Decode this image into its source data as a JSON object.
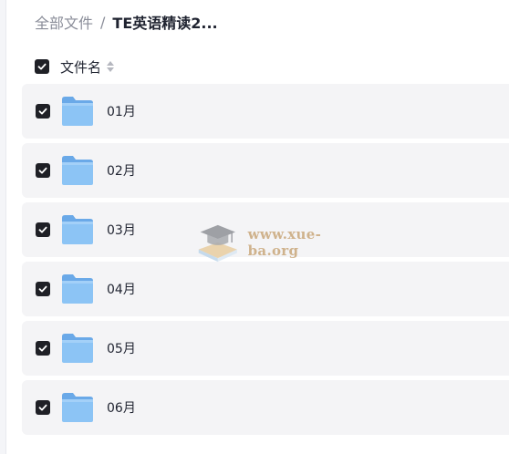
{
  "breadcrumb": {
    "root": "全部文件",
    "separator": "/",
    "current": "TE英语精读2..."
  },
  "list_header": {
    "checked": true,
    "column_label": "文件名"
  },
  "files": [
    {
      "name": "01月",
      "checked": true,
      "icon": "folder-icon"
    },
    {
      "name": "02月",
      "checked": true,
      "icon": "folder-icon"
    },
    {
      "name": "03月",
      "checked": true,
      "icon": "folder-icon"
    },
    {
      "name": "04月",
      "checked": true,
      "icon": "folder-icon"
    },
    {
      "name": "05月",
      "checked": true,
      "icon": "folder-icon"
    },
    {
      "name": "06月",
      "checked": true,
      "icon": "folder-icon"
    }
  ],
  "watermark": {
    "text": "www.xue-ba.org"
  },
  "colors": {
    "row_bg": "#f4f4f6",
    "checkbox": "#1f2026",
    "folder": "#7fb9f0"
  }
}
